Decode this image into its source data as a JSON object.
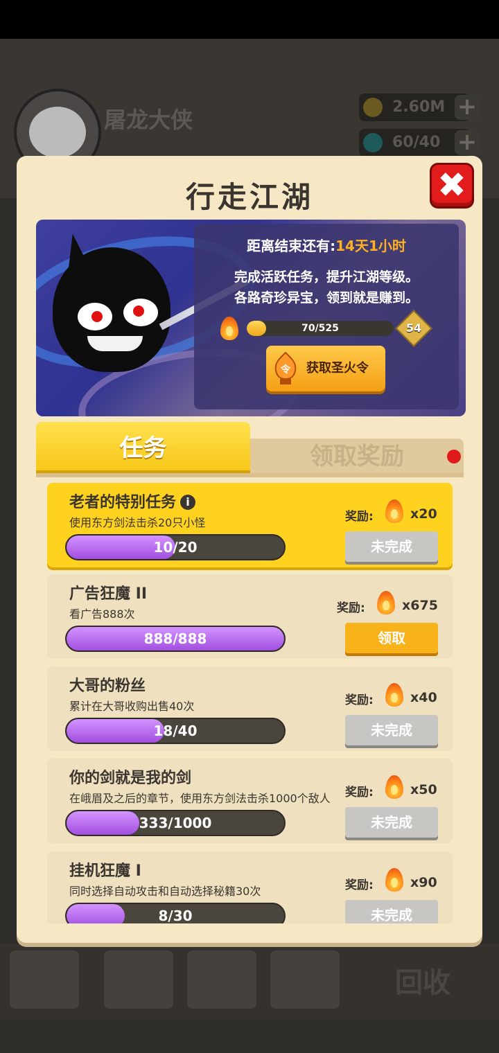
{
  "background": {
    "player_name": "屠龙大侠",
    "resources": [
      {
        "icon": "coin-icon",
        "value": "2.60M"
      },
      {
        "icon": "gem-icon",
        "value": "60/40"
      }
    ],
    "nav_text": "回收"
  },
  "modal": {
    "title": "行走江湖",
    "close_icon": "close-icon",
    "banner": {
      "countdown_label": "距离结束还有:",
      "countdown_value": "14天1小时",
      "desc_line1": "完成活跃任务，提升江湖等级。",
      "desc_line2": "各路奇珍异宝，领到就是赚到。",
      "progress_text": "70/525",
      "progress_fraction": 0.133,
      "level": "54",
      "token_button": "获取圣火令",
      "token_icon_char": "令"
    },
    "tabs": [
      {
        "label": "任务",
        "active": true
      },
      {
        "label": "领取奖励",
        "active": false,
        "has_notification": true
      }
    ],
    "reward_label": "奖励:",
    "tasks": [
      {
        "title": "老者的特别任务",
        "has_info": true,
        "desc": "使用东方剑法击杀20只小怪",
        "progress": "10/20",
        "fraction": 0.5,
        "reward": "x20",
        "button": "未完成",
        "state": "incomplete",
        "highlight": true
      },
      {
        "title": "广告狂魔 II",
        "has_info": false,
        "desc": "看广告888次",
        "progress": "888/888",
        "fraction": 1.0,
        "reward": "x675",
        "button": "领取",
        "state": "claim",
        "highlight": false
      },
      {
        "title": "大哥的粉丝",
        "has_info": false,
        "desc": "累计在大哥收购出售40次",
        "progress": "18/40",
        "fraction": 0.45,
        "reward": "x40",
        "button": "未完成",
        "state": "incomplete",
        "highlight": false
      },
      {
        "title": "你的剑就是我的剑",
        "has_info": false,
        "desc": "在峨眉及之后的章节，使用东方剑法击杀1000个敌人",
        "progress": "333/1000",
        "fraction": 0.333,
        "reward": "x50",
        "button": "未完成",
        "state": "incomplete",
        "highlight": false
      },
      {
        "title": "挂机狂魔 I",
        "has_info": false,
        "desc": "同时选择自动攻击和自动选择秘籍30次",
        "progress": "8/30",
        "fraction": 0.267,
        "reward": "x90",
        "button": "未完成",
        "state": "incomplete",
        "highlight": false
      }
    ]
  },
  "colors": {
    "accent_yellow": "#ffd21f",
    "purple_progress": "#a24ee0",
    "close_red": "#e21b1b"
  }
}
